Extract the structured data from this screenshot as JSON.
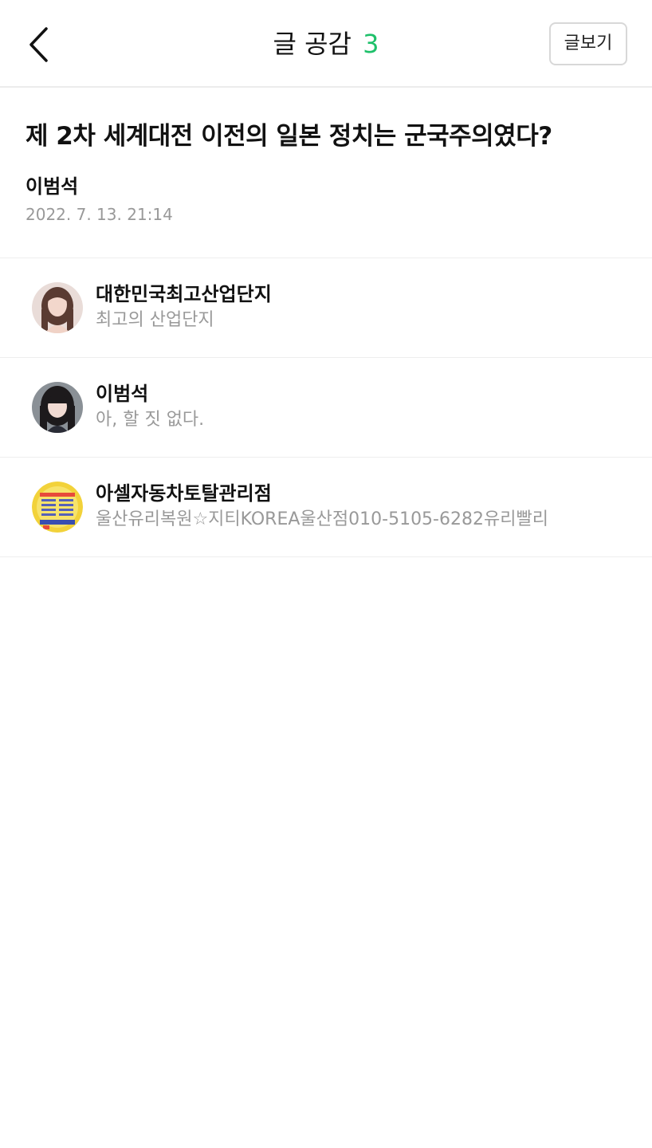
{
  "header": {
    "title": "글 공감",
    "count": "3",
    "view_post_label": "글보기"
  },
  "post": {
    "title": "제 2차 세계대전 이전의 일본 정치는 군국주의였다?",
    "author": "이범석",
    "date": "2022. 7. 13. 21:14"
  },
  "likes": [
    {
      "name": "대한민국최고산업단지",
      "description": "최고의 산업단지",
      "avatar_icon": "avatar-woman-long-hair"
    },
    {
      "name": "이범석",
      "description": "아, 할 짓 없다.",
      "avatar_icon": "avatar-woman-bangs"
    },
    {
      "name": "아셀자동차토탈관리점",
      "description": "울산유리복원☆지티KOREA울산점010-5105-6282유리빨리",
      "avatar_icon": "avatar-shop-logo"
    }
  ],
  "colors": {
    "accent_green": "#1ec06a",
    "secondary_text": "#999999",
    "divider": "#eeeeee"
  }
}
